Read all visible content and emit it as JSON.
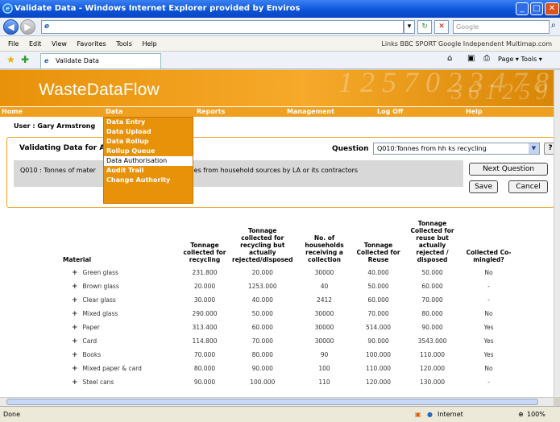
{
  "window": {
    "title": "Validate Data - Windows Internet Explorer provided by Enviros"
  },
  "browser": {
    "address_url": "",
    "search_placeholder": "Google",
    "menus": [
      "File",
      "Edit",
      "View",
      "Favorites",
      "Tools",
      "Help"
    ],
    "links_bar": "Links  BBC SPORT   Google   Independent   Multimap.com",
    "tab_title": "Validate Data",
    "toolbar_right": "Page ▾   Tools ▾"
  },
  "site": {
    "logo": "WasteDataFlow",
    "nav": [
      "Home",
      "Data",
      "Reports",
      "Management",
      "Log Off",
      "Help"
    ],
    "user_label": "User : Gary Armstrong",
    "data_menu": [
      "Data Entry",
      "Data Upload",
      "Data Rollup",
      "Rollup Queue",
      "Data Authorisation",
      "Audit Trail",
      "Change Authority"
    ],
    "data_menu_selected": 4
  },
  "panel": {
    "title": "Validating Data for Ap",
    "question_label": "Question",
    "question_select": "Q010:Tonnes from hh ks recycling",
    "help_label": "?",
    "question_text_1": "Q010 :  Tonnes of mater",
    "question_text_2": "e schemes from household sources by LA or its contractors",
    "next_button": "Next Question",
    "save_button": "Save",
    "cancel_button": "Cancel"
  },
  "table": {
    "headers": [
      "Material",
      "Tonnage collected for recycling",
      "Tonnage collected for recycling but actually rejected/disposed",
      "No. of households receiving a collection",
      "Tonnage Collected for Reuse",
      "Tonnage Collected for reuse but actually rejected / disposed",
      "Collected Co-mingled?"
    ],
    "rows": [
      [
        "Green glass",
        "231.800",
        "20.000",
        "30000",
        "40.000",
        "50.000",
        "No"
      ],
      [
        "Brown glass",
        "20.000",
        "1253.000",
        "40",
        "50.000",
        "60.000",
        "-"
      ],
      [
        "Clear glass",
        "30.000",
        "40.000",
        "2412",
        "60.000",
        "70.000",
        "-"
      ],
      [
        "Mixed glass",
        "290.000",
        "50.000",
        "30000",
        "70.000",
        "80.000",
        "No"
      ],
      [
        "Paper",
        "313.400",
        "60.000",
        "30000",
        "514.000",
        "90.000",
        "Yes"
      ],
      [
        "Card",
        "114.800",
        "70.000",
        "30000",
        "90.000",
        "3543.000",
        "Yes"
      ],
      [
        "Books",
        "70.000",
        "80.000",
        "90",
        "100.000",
        "110.000",
        "Yes"
      ],
      [
        "Mixed paper & card",
        "80.000",
        "90.000",
        "100",
        "110.000",
        "120.000",
        "No"
      ],
      [
        "Steel cans",
        "90.000",
        "100.000",
        "110",
        "120.000",
        "130.000",
        "-"
      ]
    ]
  },
  "status": {
    "left": "Done",
    "zone": "Internet",
    "zoom": "100%"
  }
}
